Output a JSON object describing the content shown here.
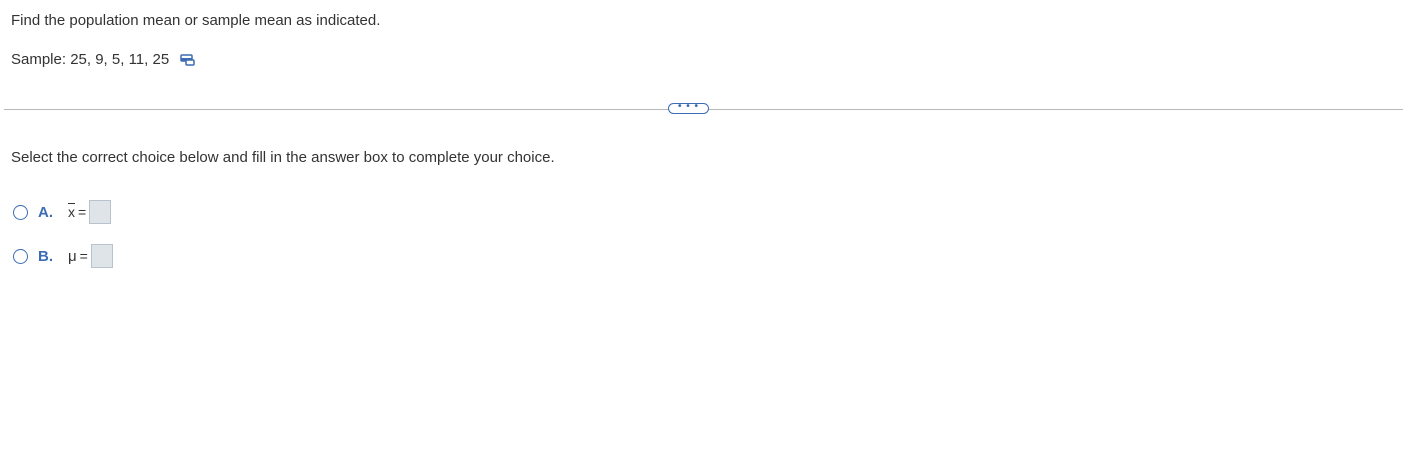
{
  "question": {
    "prompt": "Find the population mean or sample mean as indicated.",
    "sample_label": "Sample: 25, 9, 5, 11, 25",
    "copy_icon": "copy-data-icon"
  },
  "more_button": {
    "label": "• • •"
  },
  "instruction": "Select the correct choice below and fill in the answer box to complete your choice.",
  "choices": [
    {
      "letter": "A.",
      "symbol": "x",
      "equals": "=",
      "answer": ""
    },
    {
      "letter": "B.",
      "symbol": "μ",
      "equals": "=",
      "answer": ""
    }
  ],
  "colors": {
    "accent": "#3c6cb4",
    "text": "#333333",
    "answer_box_bg": "#dfe4e9",
    "divider": "#b8b8b8"
  }
}
